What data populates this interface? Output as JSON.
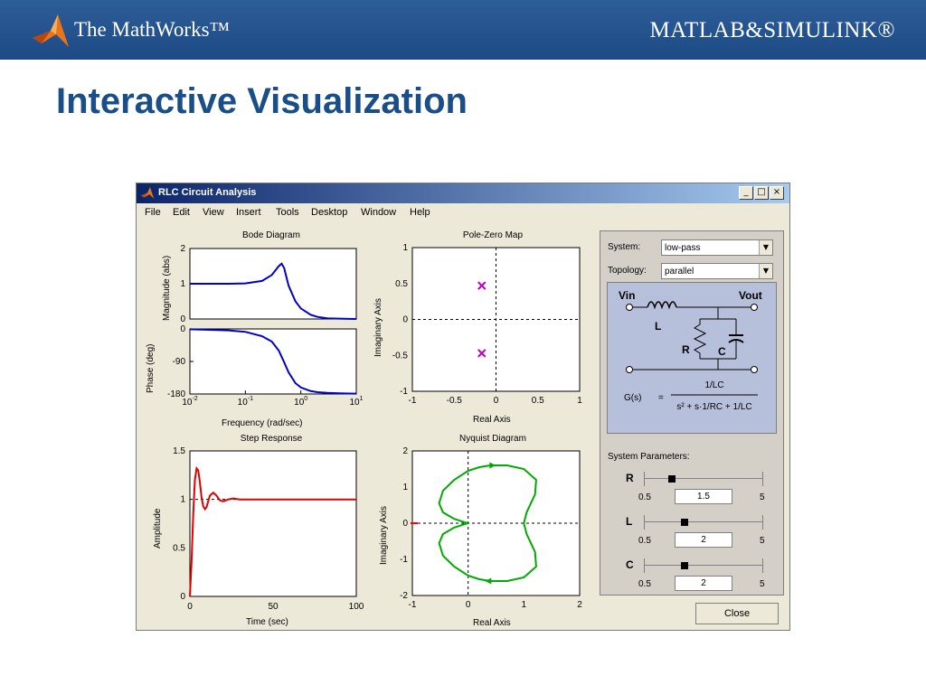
{
  "banner": {
    "company": "The MathWorks™",
    "product": "MATLAB&SIMULINK®"
  },
  "slide": {
    "title": "Interactive Visualization"
  },
  "window": {
    "title": "RLC Circuit Analysis",
    "controls": [
      "_",
      "□",
      "×"
    ],
    "menu": [
      "File",
      "Edit",
      "View",
      "Insert",
      "Tools",
      "Desktop",
      "Window",
      "Help"
    ]
  },
  "chart_data": [
    {
      "type": "line",
      "title": "Bode Diagram",
      "xlabel": "Frequency  (rad/sec)",
      "xscale": "log",
      "xlim": [
        0.01,
        10
      ],
      "xticks": [
        "10-2",
        "10-1",
        "100",
        "101"
      ],
      "panels": [
        {
          "ylabel": "Magnitude (abs)",
          "ylim": [
            0,
            2
          ],
          "yticks": [
            "0",
            "1",
            "2"
          ],
          "x": [
            0.01,
            0.05,
            0.1,
            0.2,
            0.3,
            0.4,
            0.45,
            0.5,
            0.6,
            0.8,
            1,
            1.5,
            2,
            3,
            5,
            10
          ],
          "y": [
            1.0,
            1.0,
            1.01,
            1.08,
            1.25,
            1.5,
            1.57,
            1.45,
            0.95,
            0.5,
            0.3,
            0.12,
            0.06,
            0.02,
            0.01,
            0.0
          ]
        },
        {
          "ylabel": "Phase (deg)",
          "ylim": [
            -180,
            0
          ],
          "yticks": [
            "0",
            "-90",
            "-180"
          ],
          "x": [
            0.01,
            0.05,
            0.1,
            0.2,
            0.3,
            0.4,
            0.5,
            0.6,
            0.8,
            1,
            1.5,
            2,
            3,
            5,
            10
          ],
          "y": [
            -1,
            -4,
            -8,
            -20,
            -35,
            -60,
            -92,
            -120,
            -150,
            -162,
            -172,
            -175,
            -177,
            -178,
            -179
          ]
        }
      ],
      "series_color": "#0000cc"
    },
    {
      "type": "scatter",
      "title": "Pole-Zero Map",
      "xlabel": "Real Axis",
      "ylabel": "Imaginary Axis",
      "xlim": [
        -1,
        1
      ],
      "ylim": [
        -1,
        1
      ],
      "xticks": [
        "-1",
        "-0.5",
        "0",
        "0.5",
        "1"
      ],
      "yticks": [
        "1",
        "0.5",
        "0",
        "-0.5",
        "-1"
      ],
      "points": [
        {
          "x": -0.17,
          "y": 0.47
        },
        {
          "x": -0.17,
          "y": -0.47
        }
      ],
      "marker": "x",
      "series_color": "#c000c0"
    },
    {
      "type": "line",
      "title": "Step Response",
      "xlabel": "Time (sec)",
      "ylabel": "Amplitude",
      "xlim": [
        0,
        100
      ],
      "ylim": [
        0,
        1.5
      ],
      "xticks": [
        "0",
        "50",
        "100"
      ],
      "yticks": [
        "1.5",
        "1",
        "0.5",
        "0"
      ],
      "x": [
        0,
        1,
        2,
        3,
        4,
        5,
        6,
        7,
        8,
        9,
        10,
        11,
        12,
        14,
        16,
        18,
        20,
        23,
        26,
        30,
        35,
        40,
        50,
        60,
        70,
        80,
        90,
        100
      ],
      "y": [
        0,
        0.35,
        0.85,
        1.2,
        1.32,
        1.3,
        1.18,
        1.02,
        0.93,
        0.9,
        0.92,
        0.98,
        1.04,
        1.07,
        1.04,
        0.99,
        0.98,
        1.0,
        1.01,
        1.0,
        1.0,
        1.0,
        1.0,
        1.0,
        1.0,
        1.0,
        1.0,
        1.0
      ],
      "series_color": "#e00000"
    },
    {
      "type": "line",
      "title": "Nyquist Diagram",
      "xlabel": "Real Axis",
      "ylabel": "Imaginary Axis",
      "xlim": [
        -1,
        2
      ],
      "ylim": [
        -2,
        2
      ],
      "xticks": [
        "-1",
        "0",
        "1",
        "2"
      ],
      "yticks": [
        "2",
        "1",
        "0",
        "-1",
        "-2"
      ],
      "x": [
        1,
        1.05,
        1.2,
        1.22,
        1.0,
        0.7,
        0.4,
        0.2,
        0.0,
        -0.25,
        -0.45,
        -0.52,
        -0.45,
        -0.25,
        -0.05,
        0.0,
        -0.05,
        -0.25,
        -0.45,
        -0.52,
        -0.45,
        -0.25,
        0.0,
        0.2,
        0.4,
        0.7,
        1.0,
        1.22,
        1.2,
        1.05,
        1.0
      ],
      "y": [
        0.0,
        0.3,
        0.8,
        1.2,
        1.5,
        1.6,
        1.6,
        1.55,
        1.45,
        1.2,
        0.9,
        0.55,
        0.3,
        0.12,
        0.02,
        0.0,
        -0.02,
        -0.12,
        -0.3,
        -0.55,
        -0.9,
        -1.2,
        -1.45,
        -1.55,
        -1.6,
        -1.6,
        -1.5,
        -1.2,
        -0.8,
        -0.3,
        0.0
      ],
      "series_color": "#00aa00",
      "critical_point": {
        "x": -1,
        "y": 0,
        "color": "#ff0000"
      }
    }
  ],
  "panel": {
    "system_label": "System:",
    "system_value": "low-pass",
    "topology_label": "Topology:",
    "topology_value": "parallel",
    "circuit": {
      "vin": "Vin",
      "vout": "Vout",
      "L": "L",
      "R": "R",
      "C": "C",
      "tf_lhs": "G(s)",
      "tf_eq": "=",
      "tf_num": "1/LC",
      "tf_den": "s² + s·1/RC + 1/LC"
    },
    "params_label": "System Parameters:",
    "params": [
      {
        "name": "R",
        "min": "0.5",
        "max": "5",
        "value": "1.5",
        "level": 0.22
      },
      {
        "name": "L",
        "min": "0.5",
        "max": "5",
        "value": "2",
        "level": 0.33
      },
      {
        "name": "C",
        "min": "0.5",
        "max": "5",
        "value": "2",
        "level": 0.33
      }
    ],
    "close_label": "Close"
  }
}
